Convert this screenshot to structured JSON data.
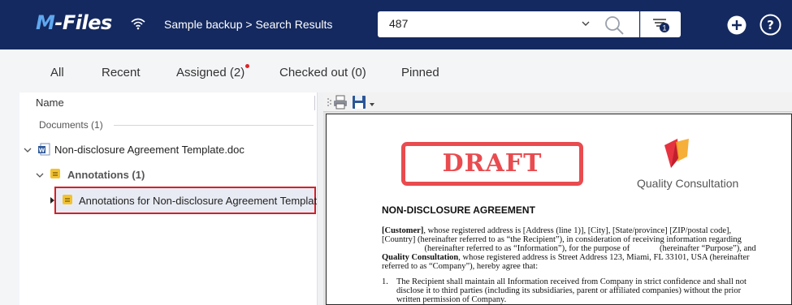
{
  "header": {
    "logo_text": "M-Files",
    "breadcrumb": "Sample backup > Search Results",
    "search_value": "487",
    "filter_badge": "1"
  },
  "tabs": [
    {
      "label": "All"
    },
    {
      "label": "Recent"
    },
    {
      "label": "Assigned (2)"
    },
    {
      "label": "Checked out (0)"
    },
    {
      "label": "Pinned"
    }
  ],
  "list": {
    "column_name": "Name",
    "group_label": "Documents (1)",
    "document": "Non-disclosure Agreement Template.doc",
    "annotations_group": "Annotations (1)",
    "annotation_item": "Annotations for Non-disclosure Agreement Templat..."
  },
  "preview": {
    "stamp": "DRAFT",
    "company": "Quality Consultation",
    "title": "NON-DISCLOSURE AGREEMENT",
    "p1": [
      {
        "b": "[Customer]",
        "t": ", whose registered address is [Address (line 1)], [City], [State/province] [ZIP/postal code],"
      },
      {
        "b": "",
        "t": "[Country] (hereinafter referred to as “the Recipient”), in consideration of receiving information regarding"
      },
      {
        "b": "",
        "t": "                    (hereinafter referred to as “Information”), for the purpose of              (hereinafter “Purpose”), and"
      },
      {
        "b": "Quality Consultation",
        "t": ", whose registered address is Street Address 123, Miami, FL 33101, USA (hereinafter"
      },
      {
        "b": "",
        "t": "referred to as “Company”), hereby agree that:"
      }
    ],
    "item_number": "1.",
    "item_lines": [
      "The Recipient shall maintain all Information received from Company in strict confidence and shall not",
      "disclose it to third parties (including its subsidiaries, parent or affiliated companies) without the prior",
      "written permission of Company."
    ]
  },
  "colors": {
    "topbar": "#14295f",
    "accent_blue": "#5fa8f0",
    "highlight_border": "#d42027",
    "stamp_red": "#e94b4f",
    "notification_dot": "#e02424"
  }
}
